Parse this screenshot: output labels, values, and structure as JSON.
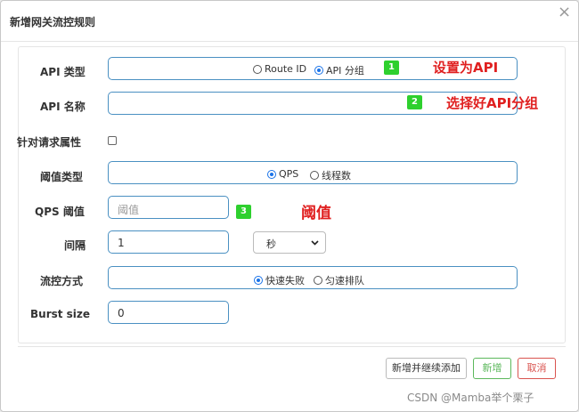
{
  "dialog": {
    "title": "新增网关流控规则",
    "close_glyph": "×"
  },
  "form": {
    "api_type": {
      "label": "API 类型",
      "options": [
        "Route ID",
        "API 分组"
      ],
      "selected": "API 分组"
    },
    "api_name": {
      "label": "API 名称",
      "value": ""
    },
    "request_attr": {
      "label": "针对请求属性",
      "checked": false
    },
    "threshold_type": {
      "label": "阈值类型",
      "options": [
        "QPS",
        "线程数"
      ],
      "selected": "QPS"
    },
    "qps_threshold": {
      "label": "QPS 阈值",
      "placeholder": "阈值"
    },
    "interval": {
      "label": "间隔",
      "value": "1",
      "unit": "秒"
    },
    "control_mode": {
      "label": "流控方式",
      "options": [
        "快速失败",
        "匀速排队"
      ],
      "selected": "快速失败"
    },
    "burst": {
      "label": "Burst size",
      "value": "0"
    }
  },
  "annotations": {
    "badge1": "1",
    "note1": "设置为API",
    "badge2": "2",
    "note2": "选择好API分组",
    "badge3": "3",
    "note3": "阈值"
  },
  "buttons": {
    "add_continue": "新增并继续添加",
    "add": "新增",
    "cancel": "取消"
  },
  "colors": {
    "accent_border": "#4a90c2",
    "annotation": "#e02020",
    "badge": "#2ed02e",
    "add_button": "#5cb85c",
    "cancel_button": "#d9534f"
  },
  "watermark": "CSDN @Mamba举个栗子"
}
